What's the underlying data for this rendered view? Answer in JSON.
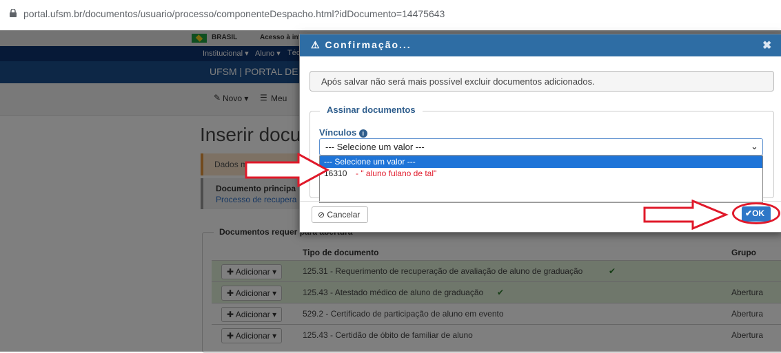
{
  "browser": {
    "url": "portal.ufsm.br/documentos/usuario/processo/componenteDespacho.html?idDocumento=14475643"
  },
  "govbar": {
    "brasil": "BRASIL",
    "acesso": "Acesso à inf"
  },
  "nav": {
    "institucional": "Institucional ▾",
    "aluno": "Aluno ▾",
    "tec": "Téc",
    "portal_title": "UFSM | PORTAL DE"
  },
  "toolbar": {
    "novo": "Novo ▾",
    "meu": "Meu"
  },
  "page": {
    "heading": "Inserir docum",
    "dados_box": "Dados modificad",
    "doc_principal_label": "Documento principa",
    "doc_principal_link": "Processo de recupera",
    "docs_req_legend": "Documentos requer",
    "docs_req_legend_tail": "para abertura"
  },
  "table": {
    "headers": [
      "Tipo de documento",
      "Grupo"
    ],
    "add_label": "Adicionar",
    "rows": [
      {
        "tipo": "125.31 - Requerimento de recuperação de avaliação de aluno de graduação",
        "check": "✔",
        "grupo": "",
        "highlight": true
      },
      {
        "tipo": "125.43 - Atestado médico de aluno de graduação",
        "check": "✔",
        "grupo": "Abertura",
        "highlight": true
      },
      {
        "tipo": "529.2 - Certificado de participação de aluno em evento",
        "check": "",
        "grupo": "Abertura",
        "highlight": false
      },
      {
        "tipo": "125.43 - Certidão de óbito de familiar de aluno",
        "check": "",
        "grupo": "Abertura",
        "highlight": false
      }
    ]
  },
  "modal": {
    "title": "Confirmação...",
    "alert": "Após salvar não será mais possível excluir documentos adicionados.",
    "fieldset_legend": "Assinar documentos",
    "vinculos_label": "Vínculos",
    "select_value": "--- Selecione um valor ---",
    "options": [
      "--- Selecione um valor ---",
      "16310"
    ],
    "option_annotation": "- \" aluno fulano de tal\"",
    "cancel": "Cancelar",
    "ok": "OK"
  },
  "colors": {
    "modal_header": "#2e6da4",
    "ok_button": "#2e77c7",
    "annotation_red": "#e0192a",
    "row_highlight": "#dfeed7"
  },
  "icons": [
    "lock-icon",
    "warning-icon",
    "close-icon",
    "info-icon",
    "chevron-down-icon",
    "ban-icon",
    "check-icon",
    "plus-icon",
    "pencil-icon",
    "list-icon",
    "red-arrow-annotation"
  ]
}
